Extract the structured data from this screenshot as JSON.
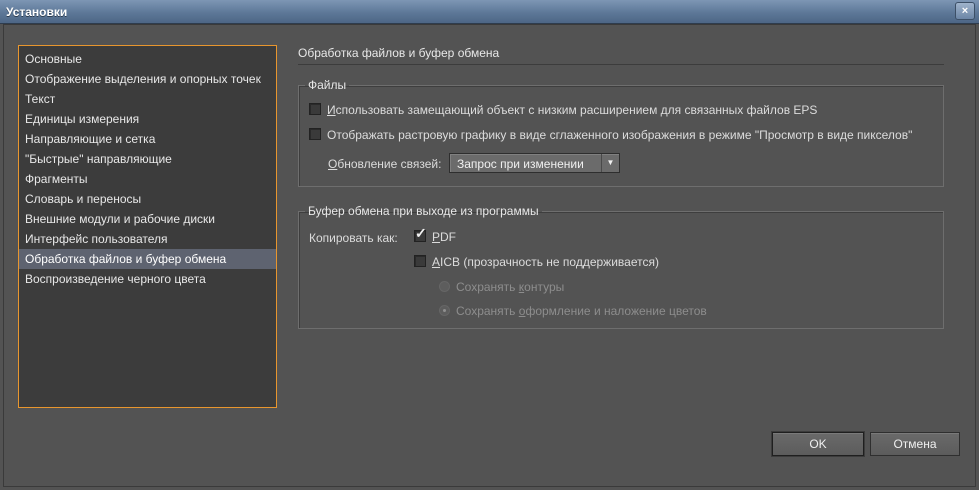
{
  "window": {
    "title": "Установки",
    "close_label": "×"
  },
  "sidebar": {
    "items": [
      {
        "label": "Основные",
        "selected": false
      },
      {
        "label": "Отображение выделения и опорных точек",
        "selected": false
      },
      {
        "label": "Текст",
        "selected": false
      },
      {
        "label": "Единицы измерения",
        "selected": false
      },
      {
        "label": "Направляющие и сетка",
        "selected": false
      },
      {
        "label": "\"Быстрые\" направляющие",
        "selected": false
      },
      {
        "label": "Фрагменты",
        "selected": false
      },
      {
        "label": "Словарь и переносы",
        "selected": false
      },
      {
        "label": "Внешние модули и рабочие диски",
        "selected": false
      },
      {
        "label": "Интерфейс пользователя",
        "selected": false
      },
      {
        "label": "Обработка файлов и буфер обмена",
        "selected": true
      },
      {
        "label": "Воспроизведение черного цвета",
        "selected": false
      }
    ]
  },
  "main": {
    "heading": "Обработка файлов и буфер обмена",
    "files": {
      "legend": "Файлы",
      "low_res_proxy": {
        "label_underlined": "И",
        "label_rest": "спользовать замещающий объект с низким расширением для связанных файлов EPS",
        "checked": false
      },
      "pixel_preview": {
        "label": "Отображать растровую графику в виде сглаженного изображения в режиме \"Просмотр в виде пикселов\"",
        "checked": false
      },
      "update_links": {
        "label_underlined": "О",
        "label_rest": "бновление связей:",
        "value": "Запрос при изменении"
      }
    },
    "clipboard": {
      "legend": "Буфер обмена при выходе из программы",
      "copy_as_label": "Копировать как:",
      "pdf": {
        "label_underlined": "P",
        "label_rest": "DF",
        "checked": true
      },
      "aicb": {
        "label_underlined": "A",
        "label_rest": "ICB (прозрачность не поддерживается)",
        "checked": false
      },
      "preserve_paths": {
        "label_prefix": "Сохранять ",
        "label_underlined": "к",
        "label_rest": "онтуры",
        "checked": false,
        "enabled": false
      },
      "preserve_appearance": {
        "label_prefix": "Сохранять ",
        "label_underlined": "о",
        "label_rest": "формление и наложение цветов",
        "checked": true,
        "enabled": false
      }
    }
  },
  "buttons": {
    "ok": "OK",
    "cancel": "Отмена"
  }
}
